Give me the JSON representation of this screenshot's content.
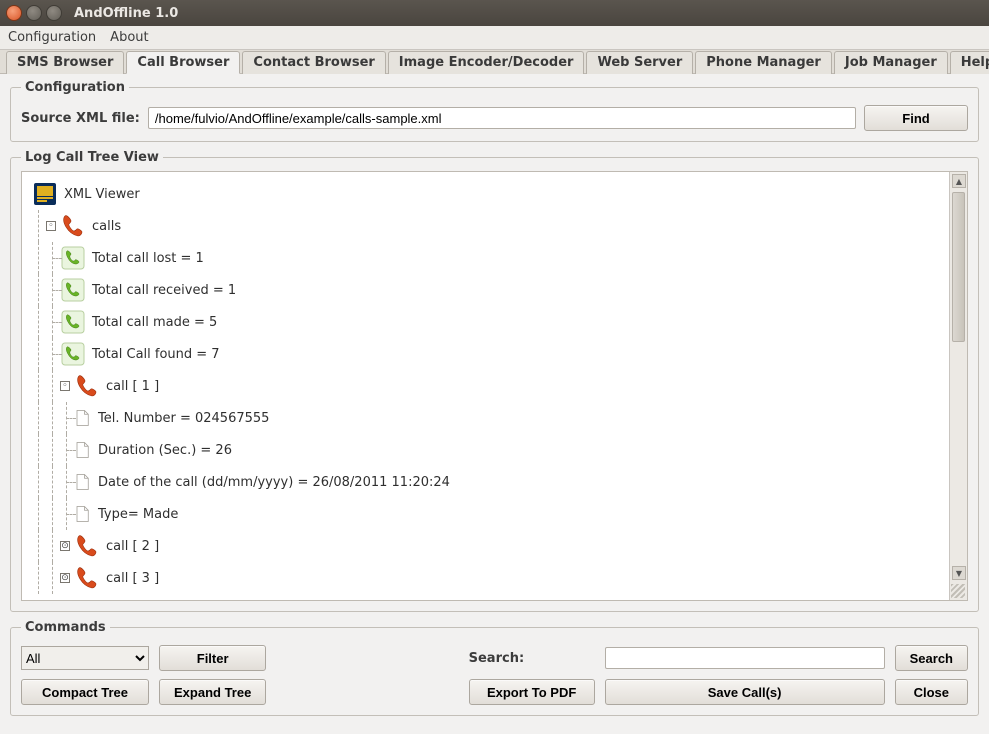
{
  "window": {
    "title": "AndOffline 1.0"
  },
  "menubar": {
    "items": [
      "Configuration",
      "About"
    ]
  },
  "tabs": {
    "active_index": 1,
    "items": [
      "SMS Browser",
      "Call Browser",
      "Contact Browser",
      "Image Encoder/Decoder",
      "Web Server",
      "Phone Manager",
      "Job Manager",
      "Help"
    ]
  },
  "config": {
    "legend": "Configuration",
    "source_label": "Source XML file:",
    "source_value": "/home/fulvio/AndOffline/example/calls-sample.xml",
    "find": "Find"
  },
  "treeview": {
    "legend": "Log Call Tree View",
    "root_label": "XML Viewer",
    "calls_label": "calls",
    "stats": [
      "Total call lost = 1",
      "Total call received = 1",
      "Total call made = 5",
      "Total Call found = 7"
    ],
    "call1": {
      "label": "call [ 1 ]",
      "fields": [
        "Tel. Number = 024567555",
        "Duration (Sec.) = 26",
        "Date of the call (dd/mm/yyyy) = 26/08/2011 11:20:24",
        "Type= Made"
      ]
    },
    "call2": "call [ 2 ]",
    "call3": "call [ 3 ]"
  },
  "commands": {
    "legend": "Commands",
    "filter_select": "All",
    "filter": "Filter",
    "search_label": "Search:",
    "search_value": "",
    "search": "Search",
    "compact": "Compact Tree",
    "expand": "Expand Tree",
    "export": "Export To PDF",
    "save": "Save Call(s)",
    "close": "Close"
  }
}
